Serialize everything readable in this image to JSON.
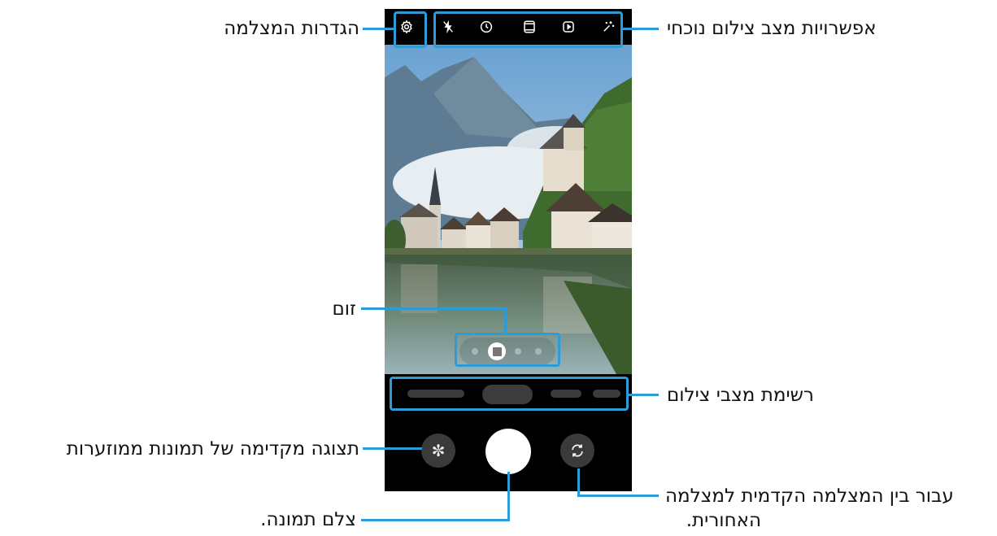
{
  "callouts": {
    "camera_settings": "הגדרות המצלמה",
    "shooting_options": "אפשרויות מצב צילום נוכחי",
    "zoom": "זום",
    "modes_list": "רשימת מצבי צילום",
    "thumbnail": "תצוגה מקדימה של תמונות ממוזערות",
    "capture": "צלם תמונה.",
    "switch_line1": "עבור בין המצלמה הקדמית למצלמה",
    "switch_line2": "האחורית."
  },
  "topbar_icons": [
    "gear-icon",
    "flash-off-icon",
    "timer-icon",
    "aspect-ratio-icon",
    "motion-photo-icon",
    "effects-icon"
  ],
  "colors": {
    "accent": "#2d9bd5",
    "phone_bg": "#000000"
  }
}
